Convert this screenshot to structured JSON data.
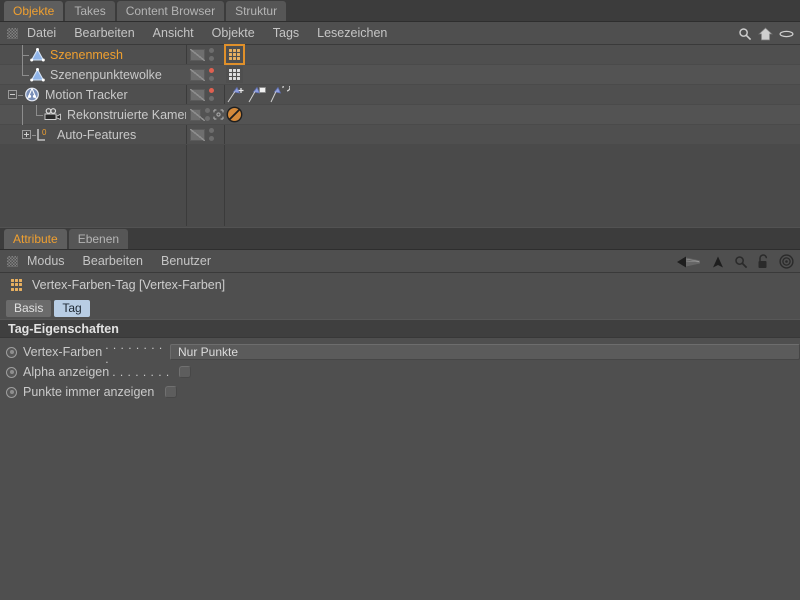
{
  "object_manager": {
    "tabs": [
      {
        "label": "Objekte",
        "active": true
      },
      {
        "label": "Takes",
        "active": false
      },
      {
        "label": "Content Browser",
        "active": false
      },
      {
        "label": "Struktur",
        "active": false
      }
    ],
    "menu": [
      "Datei",
      "Bearbeiten",
      "Ansicht",
      "Objekte",
      "Tags",
      "Lesezeichen"
    ],
    "right_icons": [
      "search-icon",
      "home-icon",
      "eye-icon"
    ],
    "columns": [
      "name",
      "layer",
      "tags"
    ],
    "rows": [
      {
        "name": "Szenenmesh",
        "icon": "polygon-object-icon",
        "depth": 1,
        "selected": true,
        "expander": "none",
        "layer_dot": "grey",
        "xform_icon": false,
        "tags": [
          {
            "type": "vertex-color-tag",
            "selected": true,
            "color": "#e8b060"
          }
        ]
      },
      {
        "name": "Szenenpunktewolke",
        "icon": "point-cloud-object-icon",
        "depth": 1,
        "selected": false,
        "expander": "none",
        "layer_dot": "red",
        "xform_icon": false,
        "tags": [
          {
            "type": "vertex-color-tag",
            "selected": false,
            "color": "#dedede"
          }
        ]
      },
      {
        "name": "Motion Tracker",
        "icon": "motion-tracker-icon",
        "depth": 0,
        "selected": false,
        "expander": "minus",
        "layer_dot": "red",
        "xform_icon": false,
        "tags": [
          {
            "type": "tracker-add-tag",
            "selected": false,
            "color": "#8f9fe0"
          },
          {
            "type": "tracker-plane-tag",
            "selected": false,
            "color": "#8f9fe0"
          },
          {
            "type": "tracker-rotate-tag",
            "selected": false,
            "color": "#8f9fe0"
          }
        ]
      },
      {
        "name": "Rekonstruierte Kamera",
        "icon": "camera-icon",
        "depth": 2,
        "selected": false,
        "expander": "none",
        "layer_dot": "grey",
        "xform_icon": true,
        "tags": [
          {
            "type": "protection-tag",
            "selected": false,
            "color": "#d4893a"
          }
        ]
      },
      {
        "name": "Auto-Features",
        "icon": "null-layer-icon",
        "depth": 1,
        "selected": false,
        "expander": "plus",
        "layer_dot": "grey",
        "xform_icon": false,
        "tags": []
      }
    ]
  },
  "attribute_manager": {
    "tabs": [
      {
        "label": "Attribute",
        "active": true
      },
      {
        "label": "Ebenen",
        "active": false
      }
    ],
    "menu": [
      "Modus",
      "Bearbeiten",
      "Benutzer"
    ],
    "right_icons": [
      "history-back-icon",
      "navigate-up-icon",
      "search-icon",
      "lock-icon",
      "target-icon"
    ],
    "object_title": "Vertex-Farben-Tag [Vertex-Farben]",
    "object_icon": "vertex-color-tag-icon",
    "subtabs": [
      {
        "label": "Basis",
        "active": false
      },
      {
        "label": "Tag",
        "active": true
      }
    ],
    "section_title": "Tag-Eigenschaften",
    "properties": [
      {
        "label": "Vertex-Farben",
        "dots": ". . . . . . . . .",
        "control": "dropdown",
        "value": "Nur Punkte"
      },
      {
        "label": "Alpha anzeigen",
        "dots": ". . . . . . . .",
        "control": "checkbox",
        "value": false
      },
      {
        "label": "Punkte immer anzeigen",
        "dots": "",
        "control": "checkbox",
        "value": false
      }
    ]
  },
  "theme": {
    "accent_orange": "#f0a030",
    "panel_bg": "#4f4f4f",
    "tabstrip_bg": "#3c3c3c",
    "section_bg": "#3f3f3f",
    "selected_tab_bg": "#b8cde4",
    "text": "#c8c8c8"
  }
}
